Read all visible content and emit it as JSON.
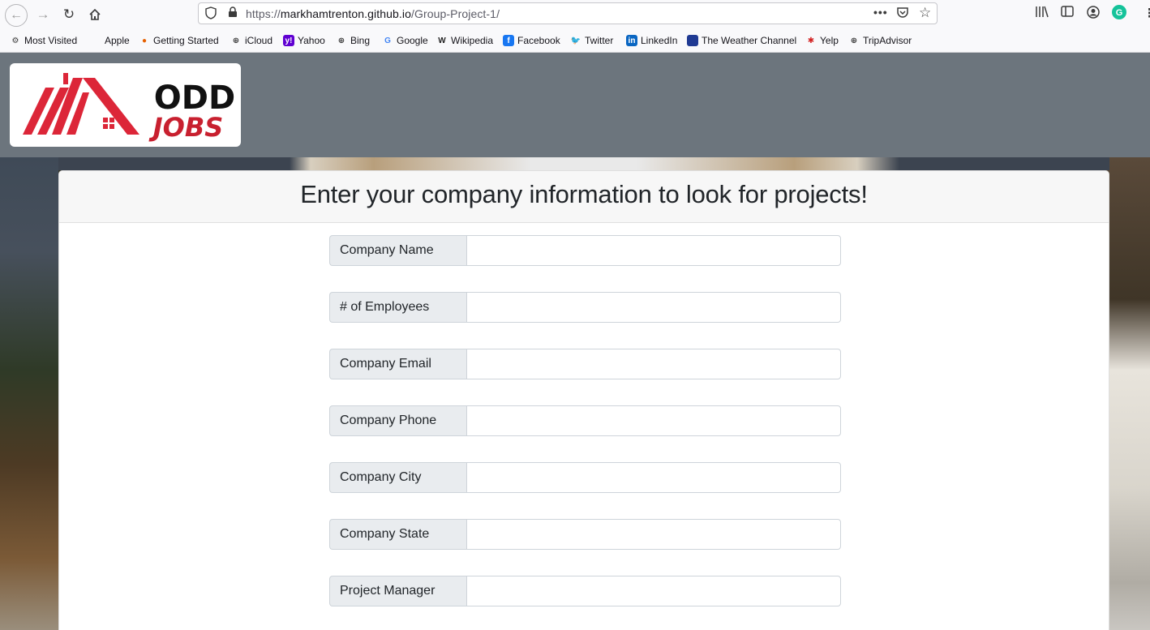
{
  "browser": {
    "url_prefix": "https://",
    "url_host": "markhamtrenton.github.io",
    "url_path": "/Group-Project-1/",
    "page_actions": "•••"
  },
  "bookmarks": [
    {
      "label": "Most Visited",
      "icon": "gear-icon",
      "glyph": "⚙",
      "bg": "transparent",
      "fg": "#3b3b3b"
    },
    {
      "label": "Apple",
      "icon": "apple-icon",
      "glyph": "",
      "bg": "transparent",
      "fg": "#555"
    },
    {
      "label": "Getting Started",
      "icon": "firefox-icon",
      "glyph": "●",
      "bg": "transparent",
      "fg": "#e66000"
    },
    {
      "label": "iCloud",
      "icon": "globe-icon",
      "glyph": "⊕",
      "bg": "transparent",
      "fg": "#3b3b3b"
    },
    {
      "label": "Yahoo",
      "icon": "yahoo-icon",
      "glyph": "y!",
      "bg": "#6001d2",
      "fg": "#fff"
    },
    {
      "label": "Bing",
      "icon": "globe-icon",
      "glyph": "⊕",
      "bg": "transparent",
      "fg": "#3b3b3b"
    },
    {
      "label": "Google",
      "icon": "google-icon",
      "glyph": "G",
      "bg": "transparent",
      "fg": "#4285f4"
    },
    {
      "label": "Wikipedia",
      "icon": "wikipedia-icon",
      "glyph": "W",
      "bg": "transparent",
      "fg": "#222"
    },
    {
      "label": "Facebook",
      "icon": "facebook-icon",
      "glyph": "f",
      "bg": "#1877f2",
      "fg": "#fff"
    },
    {
      "label": "Twitter",
      "icon": "twitter-icon",
      "glyph": "🐦",
      "bg": "transparent",
      "fg": "#1da1f2"
    },
    {
      "label": "LinkedIn",
      "icon": "linkedin-icon",
      "glyph": "in",
      "bg": "#0a66c2",
      "fg": "#fff"
    },
    {
      "label": "The Weather Channel",
      "icon": "weather-channel-icon",
      "glyph": "",
      "bg": "#1f3a93",
      "fg": "#fff"
    },
    {
      "label": "Yelp",
      "icon": "yelp-icon",
      "glyph": "✱",
      "bg": "transparent",
      "fg": "#d32323"
    },
    {
      "label": "TripAdvisor",
      "icon": "globe-icon",
      "glyph": "⊕",
      "bg": "transparent",
      "fg": "#3b3b3b"
    }
  ],
  "logo": {
    "line1": "ODD",
    "line2": "JOBS",
    "colors": {
      "roof": "#dc2638",
      "text_dark": "#111111",
      "text_red": "#c8202f"
    }
  },
  "form": {
    "title": "Enter your company information to look for projects!",
    "fields": [
      {
        "label": "Company Name",
        "value": ""
      },
      {
        "label": "# of Employees",
        "value": ""
      },
      {
        "label": "Company Email",
        "value": ""
      },
      {
        "label": "Company Phone",
        "value": ""
      },
      {
        "label": "Company City",
        "value": ""
      },
      {
        "label": "Company State",
        "value": ""
      },
      {
        "label": "Project Manager",
        "value": ""
      }
    ]
  },
  "colors": {
    "navbar": "#6c757d",
    "input_group_bg": "#e9ecef",
    "grammarly": "#15c39a"
  }
}
